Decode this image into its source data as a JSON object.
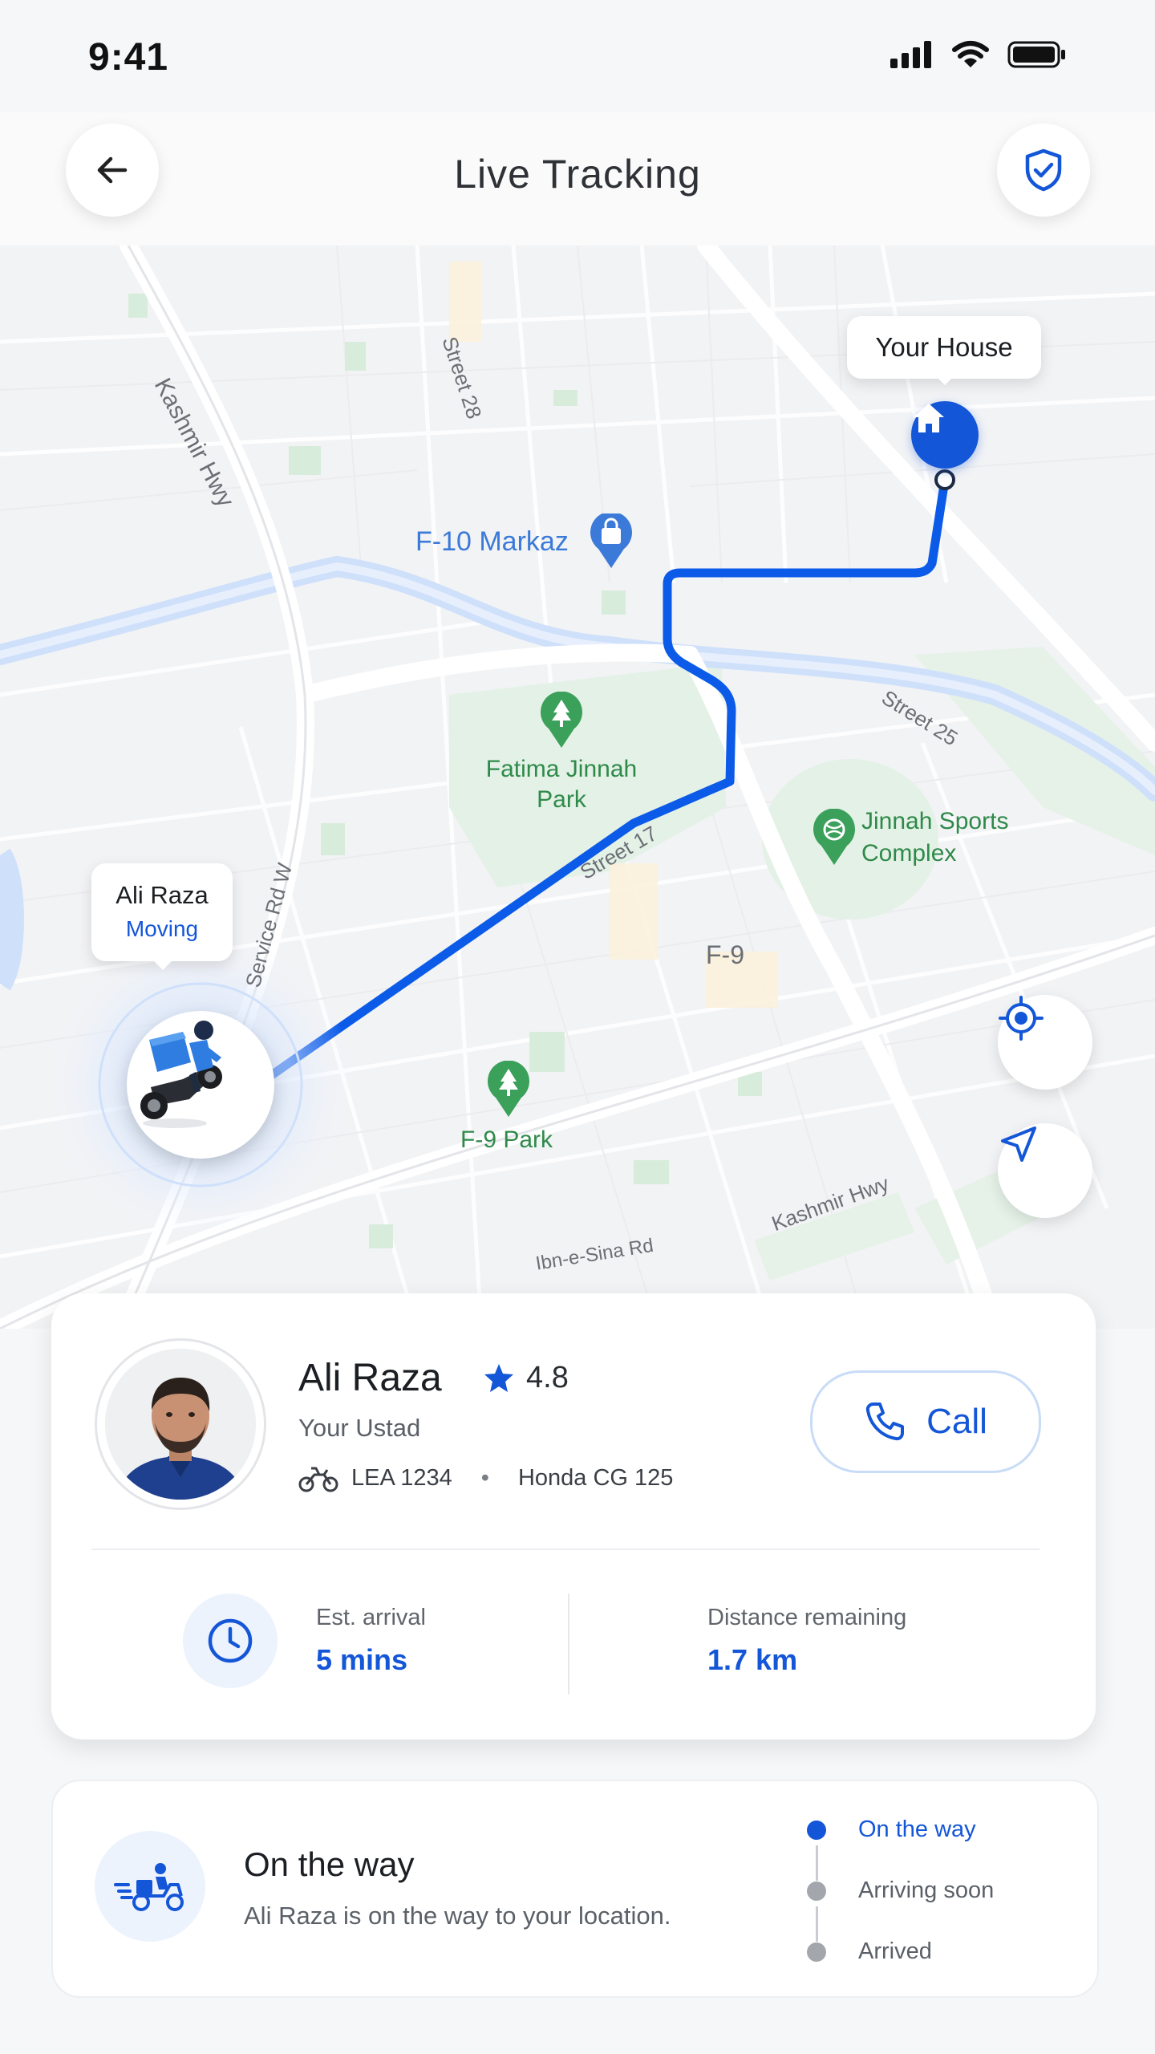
{
  "status_bar": {
    "time": "9:41"
  },
  "header": {
    "title": "Live Tracking"
  },
  "map": {
    "labels": {
      "kashmir_hwy_top": "Kashmir Hwy",
      "street_28": "Street 28",
      "f10_markaz": "F-10 Markaz",
      "service_rd": "Service Rd W",
      "street_25": "Street 25",
      "fatima_park": "Fatima Jinnah Park",
      "jinnah_complex": "Jinnah Sports Complex",
      "street_17": "Street 17",
      "f9": "F-9",
      "f9_park": "F-9 Park",
      "kashmir_hwy_bottom": "Kashmir Hwy",
      "ibn_e_sina": "Ibn-e-Sina Rd"
    },
    "destination_label": "Your House",
    "rider_bubble": {
      "name": "Ali Raza",
      "status": "Moving"
    }
  },
  "driver": {
    "name": "Ali Raza",
    "rating": "4.8",
    "role": "Your Ustad",
    "plate": "LEA 1234",
    "separator": "•",
    "bike_model": "Honda CG 125",
    "call_label": "Call"
  },
  "stats": {
    "eta_label": "Est. arrival",
    "eta_value": "5 mins",
    "distance_label": "Distance remaining",
    "distance_value": "1.7 km"
  },
  "trip_status": {
    "title": "On the way",
    "description": "Ali Raza is on the way to your location.",
    "steps": [
      {
        "label": "On the way",
        "active": true
      },
      {
        "label": "Arriving soon",
        "active": false
      },
      {
        "label": "Arrived",
        "active": false
      }
    ]
  },
  "colors": {
    "accent": "#1456d8",
    "route": "#0b5be8",
    "park_green": "#e3f1e6",
    "water": "#cfe0fb"
  },
  "icons": {
    "back": "arrow-left-icon",
    "shield": "shield-check-icon",
    "home": "home-icon",
    "locate": "crosshair-icon",
    "navigate": "navigation-arrow-icon",
    "star": "star-icon",
    "phone": "phone-icon",
    "clock": "clock-icon",
    "motorbike": "motorbike-icon",
    "delivery": "delivery-scooter-icon"
  }
}
